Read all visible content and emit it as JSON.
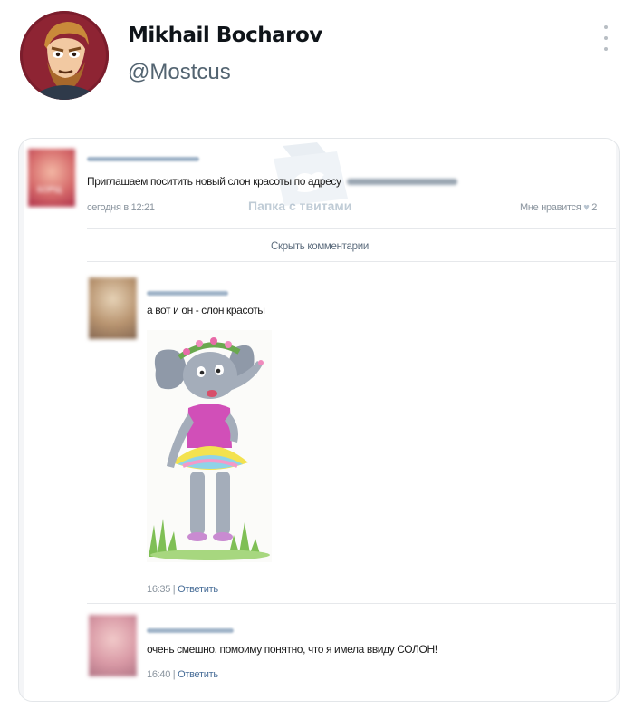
{
  "tweet": {
    "author_name": "Mikhail Bocharov",
    "author_handle": "@Mostcus",
    "more_icon": "more-vertical-icon",
    "avatar_icon": "cartoon-portrait-avatar"
  },
  "watermark": {
    "text": "Папка с твитами",
    "icon": "folder-bird-icon"
  },
  "post": {
    "text": "Приглашаем поситить новый слон красоты по адресу",
    "time": "сегодня в 12:21",
    "likes_label": "Мне нравится",
    "likes_count": "2",
    "avatar_text": "БОРЩ"
  },
  "hide_comments": "Скрыть комментарии",
  "comments": [
    {
      "text": "а вот и он - слон красоты",
      "time": "16:35",
      "reply": "Ответить",
      "image": "elephant-in-tutu-drawing"
    },
    {
      "text": "очень смешно. помоиму понятно, что я имела ввиду СОЛОН!",
      "time": "16:40",
      "reply": "Ответить"
    }
  ],
  "separator": "|"
}
